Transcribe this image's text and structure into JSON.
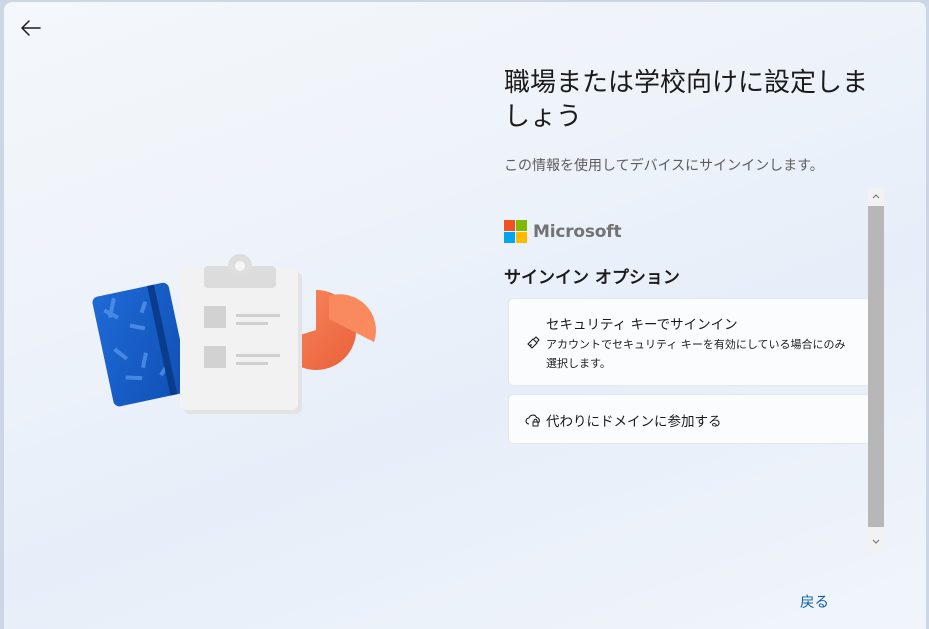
{
  "header": {
    "back_icon": "arrow-left-icon"
  },
  "main": {
    "title": "職場または学校向けに設定しましょう",
    "subtitle": "この情報を使用してデバイスにサインインします。"
  },
  "brand": {
    "name": "Microsoft",
    "colors": [
      "#f25022",
      "#7fba00",
      "#00a4ef",
      "#ffb900"
    ]
  },
  "sign_in_options": {
    "heading": "サインイン オプション",
    "security_key": {
      "icon": "security-key-icon",
      "title": "セキュリティ キーでサインイン",
      "description": "アカウントでセキュリティ キーを有効にしている場合にのみ選択します。"
    },
    "domain_join": {
      "icon": "cloud-lock-icon",
      "title": "代わりにドメインに参加する"
    }
  },
  "footer": {
    "back_label": "戻る"
  },
  "colors": {
    "accent": "#0d5fa6"
  }
}
